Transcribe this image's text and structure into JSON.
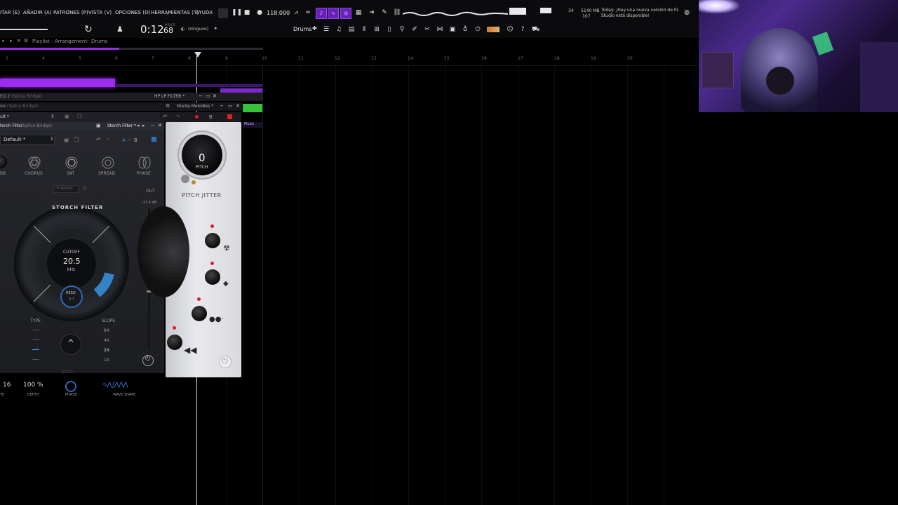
{
  "menu": {
    "items": [
      "ITAR (E)",
      "AÑADIR (A)",
      "PATRONES (P)",
      "VISTA (V)",
      "OPCIONES (O)",
      "HERRAMIENTAS (T)",
      "AYUDA"
    ]
  },
  "transport": {
    "tempo": "118.000",
    "time_main": "0:12",
    "time_sub": "68",
    "time_unit": "M:S:CS",
    "pattern_sel": "(ninguno)",
    "channel_sel": "Drums"
  },
  "status": {
    "cpu_top": "34",
    "mem": "5140 MB",
    "mem2": "107",
    "news_today": "Today",
    "news_line1": "¡Hay una nueva versión de FL",
    "news_line2": "Studio está disponible!"
  },
  "playlist": {
    "title": "Playlist - Arrangement",
    "breadcrumb": "Drums",
    "ruler": [
      "3",
      "4",
      "5",
      "6",
      "7",
      "8",
      "9",
      "10",
      "11",
      "12",
      "13",
      "14",
      "15",
      "16",
      "17",
      "18",
      "19",
      "20"
    ]
  },
  "plugins": {
    "eq_title": "EQ 2",
    "eq_sub": "(Splice Bridge)",
    "hp_title": "HP LP FILTER *",
    "ies_title": "ies",
    "ies_sub": "(Splice Bridge)",
    "murda_title": "Murda Melodies *",
    "preset_top": "ult *",
    "music_tag": "Music",
    "storch": {
      "window_title": "torch Filter",
      "window_sub": "(Splice Bridge)",
      "title2": "Storch Filter *",
      "preset": "Default *",
      "ab_a": "A",
      "ab_b": "B",
      "fx": [
        "RB",
        "CHORUS",
        "SAT",
        "SPREAD",
        "PHASE"
      ],
      "fx_boost": "FX BOOST",
      "out_label": "OUT",
      "out_db": "-17.4  dB",
      "brand": "STORCH FILTER",
      "cutoff_label": "CUTOFF",
      "cutoff_value": "20.5",
      "cutoff_unit": "kHz",
      "reso_label": "RESO",
      "reso_value": "0.7",
      "type_label": "TYPE",
      "slope_label": "SLOPE",
      "slopes": [
        "8X",
        "4X",
        "2X",
        "1X"
      ],
      "auto_label": "AUTO",
      "lfo_rate": "16",
      "lfo_depth": "100 %",
      "lfo_labels": [
        "TE",
        "DEPTH",
        "PHASE",
        "WAVE SHAPE"
      ]
    },
    "jitter": {
      "pitch_value": "0",
      "pitch_label": "PITCH",
      "title": "PITCH JITTER",
      "ab_b": "B"
    }
  },
  "colors": {
    "accent_purple": "#6a1fb8",
    "clip_purple": "#9b2cf0",
    "green_clip": "#35c23a",
    "bg": "#000000"
  }
}
